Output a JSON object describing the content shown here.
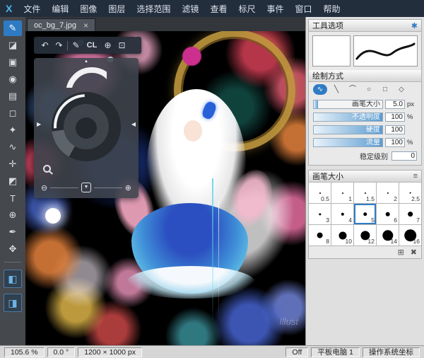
{
  "app": {
    "logo_letter": "X"
  },
  "menubar": {
    "items": [
      "文件",
      "编辑",
      "图像",
      "图层",
      "选择范围",
      "滤镜",
      "查看",
      "标尺",
      "事件",
      "窗口",
      "帮助"
    ]
  },
  "toolbar": {
    "tools": [
      {
        "name": "brush-tool",
        "glyph": "✎",
        "selected": true
      },
      {
        "name": "eraser-tool",
        "glyph": "◪"
      },
      {
        "name": "stamp-tool",
        "glyph": "▣"
      },
      {
        "name": "bucket-fill-tool",
        "glyph": "◉"
      },
      {
        "name": "gradient-tool",
        "glyph": "▤"
      },
      {
        "name": "select-marquee-tool",
        "glyph": "◻"
      },
      {
        "name": "magic-wand-tool",
        "glyph": "✦"
      },
      {
        "name": "lasso-select-tool",
        "glyph": "∿"
      },
      {
        "name": "move-tool",
        "glyph": "✛"
      },
      {
        "name": "operation-tool",
        "glyph": "◩"
      },
      {
        "name": "text-tool",
        "glyph": "T"
      },
      {
        "name": "snap-tool",
        "glyph": "⊕"
      },
      {
        "name": "eyedropper-tool",
        "glyph": "✒"
      },
      {
        "name": "hand-tool",
        "glyph": "✥"
      },
      {
        "divider": true
      },
      {
        "name": "panel-toggle-materials",
        "glyph": "◧",
        "accent": true
      },
      {
        "name": "panel-toggle-brushes",
        "glyph": "◨",
        "accent": true
      }
    ]
  },
  "canvas": {
    "tab_label": "oc_bg_7.jpg",
    "watermark": "Illust"
  },
  "floating_palette": {
    "cl_label": "CL"
  },
  "right_panel": {
    "tool_options_title": "工具选项",
    "draw_mode_title": "绘制方式",
    "draw_modes": [
      {
        "name": "mode-freehand",
        "glyph": "∿",
        "selected": true
      },
      {
        "name": "mode-line",
        "glyph": "╲"
      },
      {
        "name": "mode-polyline",
        "glyph": "⌒"
      },
      {
        "name": "mode-ellipse",
        "glyph": "○"
      },
      {
        "name": "mode-rectangle",
        "glyph": "□"
      },
      {
        "name": "mode-polygon",
        "glyph": "◇"
      }
    ],
    "sliders": [
      {
        "name": "brush-size",
        "label": "画笔大小",
        "value": "5.0",
        "unit": "px",
        "fill_pct": 6
      },
      {
        "name": "opacity",
        "label": "不透明度",
        "value": "100",
        "unit": "%",
        "fill_pct": 100
      },
      {
        "name": "hardness",
        "label": "硬度",
        "value": "100",
        "unit": "",
        "fill_pct": 100
      },
      {
        "name": "flow",
        "label": "流量",
        "value": "100",
        "unit": "%",
        "fill_pct": 100
      }
    ],
    "stabilizer": {
      "label": "稳定级别",
      "value": "0"
    },
    "brush_size_title": "画笔大小",
    "brush_sizes": [
      "0.5",
      "1",
      "1.5",
      "2",
      "2.5",
      "3",
      "4",
      "5",
      "6",
      "7",
      "8",
      "10",
      "12",
      "14",
      "16"
    ],
    "selected_brush_size": "5"
  },
  "statusbar": {
    "left": [
      {
        "label": "105.6 %",
        "name": "zoom-level"
      },
      {
        "label": "0.0 °",
        "name": "rotation-angle"
      },
      {
        "label": "1200 × 1000 px",
        "name": "canvas-size"
      }
    ],
    "right": [
      {
        "label": "Off",
        "name": "off-indicator"
      },
      {
        "label": "平板电脑 1",
        "name": "tablet-device"
      },
      {
        "label": "操作系统坐标",
        "name": "coordinate-mode"
      }
    ]
  },
  "icons": {
    "close": "×",
    "gear": "✱",
    "menu": "≡",
    "undo": "↶",
    "redo": "↷",
    "pen": "✎",
    "crosshair": "⊕",
    "window": "⊡",
    "arrow_left": "◀",
    "arrow_right": "▶",
    "zoom_out": "⊖",
    "zoom_in": "⊕",
    "marker": "▲",
    "center_tool": "▼",
    "add": "⊞",
    "delete": "✖"
  }
}
